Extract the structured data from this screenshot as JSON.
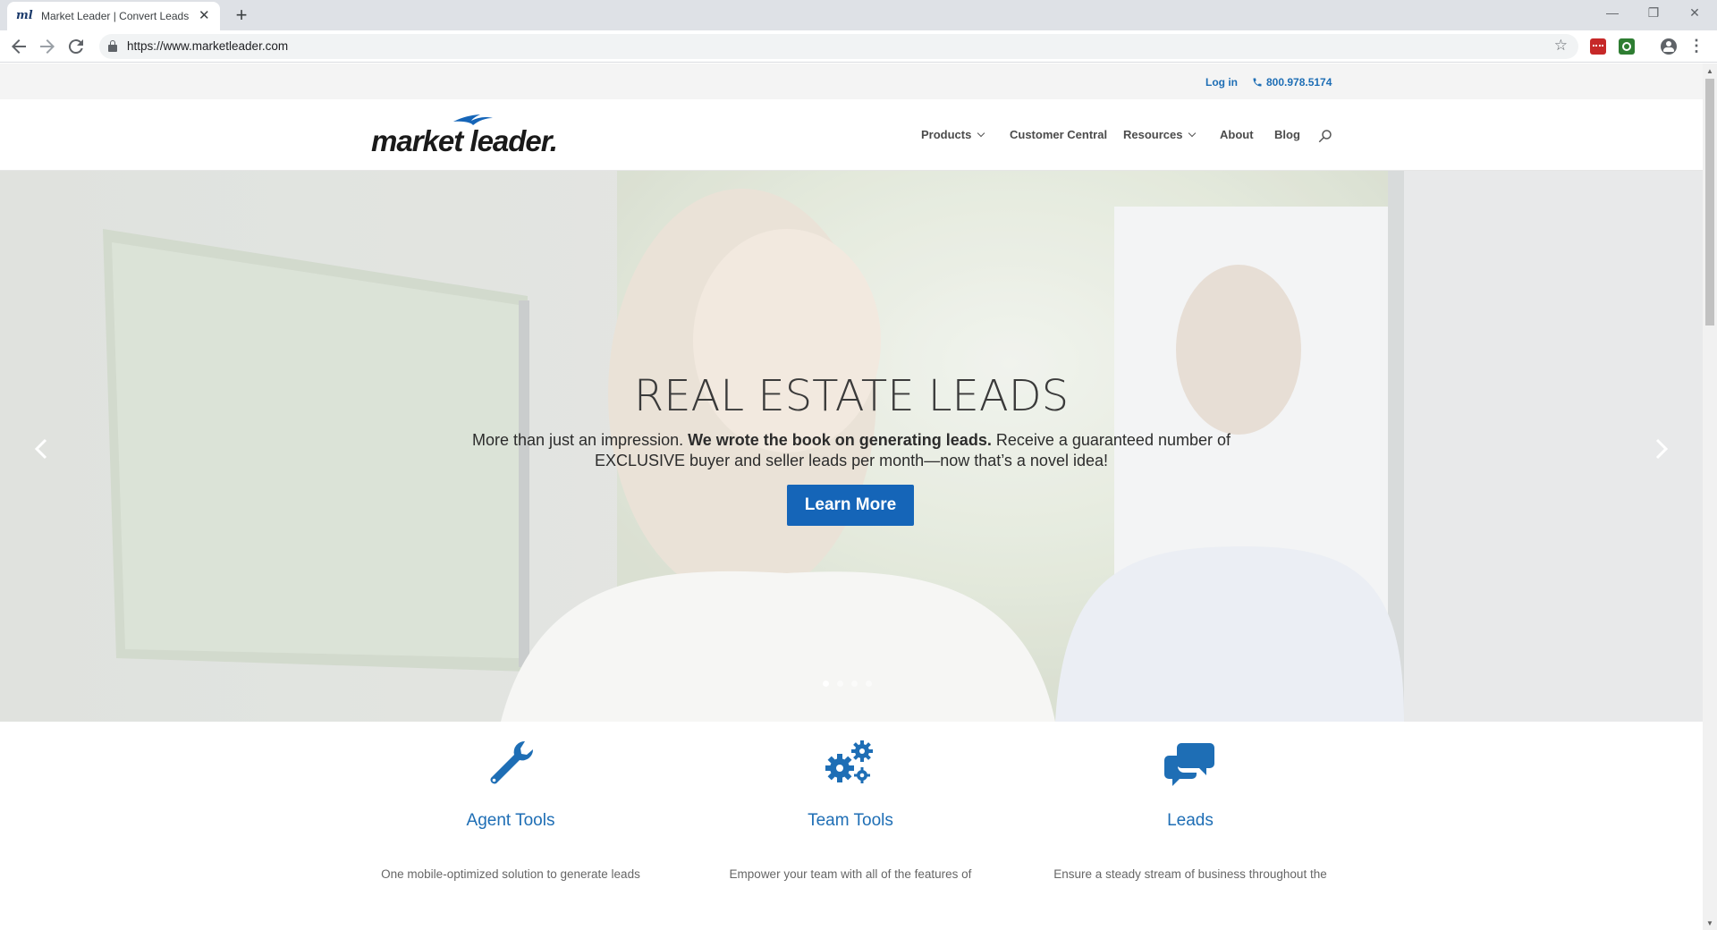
{
  "browser": {
    "tab_title": "Market Leader | Convert Leads In",
    "url": "https://www.marketleader.com",
    "favicon_text": "ml",
    "icons": {
      "back": "back-arrow-icon",
      "forward": "forward-arrow-icon",
      "reload": "reload-icon",
      "lock": "lock-icon",
      "star": "star-icon",
      "account": "account-icon",
      "menu": "kebab-menu-icon"
    }
  },
  "utility_bar": {
    "login": "Log in",
    "phone": "800.978.5174"
  },
  "header": {
    "logo_text": "market leader.",
    "nav": [
      {
        "label": "Products",
        "has_dropdown": true
      },
      {
        "label": "Customer Central",
        "has_dropdown": false
      },
      {
        "label": "Resources",
        "has_dropdown": true
      },
      {
        "label": "About",
        "has_dropdown": false
      },
      {
        "label": "Blog",
        "has_dropdown": false
      }
    ]
  },
  "hero": {
    "title": "REAL ESTATE LEADS",
    "copy_pre": "More than just an impression. ",
    "copy_bold": "We wrote the book on generating leads.",
    "copy_post": " Receive a guaranteed number of EXCLUSIVE buyer and seller leads per month—now that’s a novel idea!",
    "button": "Learn More",
    "slides": 4,
    "active_slide": 1
  },
  "features": [
    {
      "icon": "wrench-icon",
      "title": "Agent Tools",
      "desc": "One mobile-optimized solution to generate leads"
    },
    {
      "icon": "gears-icon",
      "title": "Team Tools",
      "desc": "Empower your team with all of the features of"
    },
    {
      "icon": "chat-bubbles-icon",
      "title": "Leads",
      "desc": "Ensure a steady stream of business throughout the"
    }
  ],
  "colors": {
    "brand_blue": "#1e6eb5",
    "button_blue": "#1565b8"
  }
}
